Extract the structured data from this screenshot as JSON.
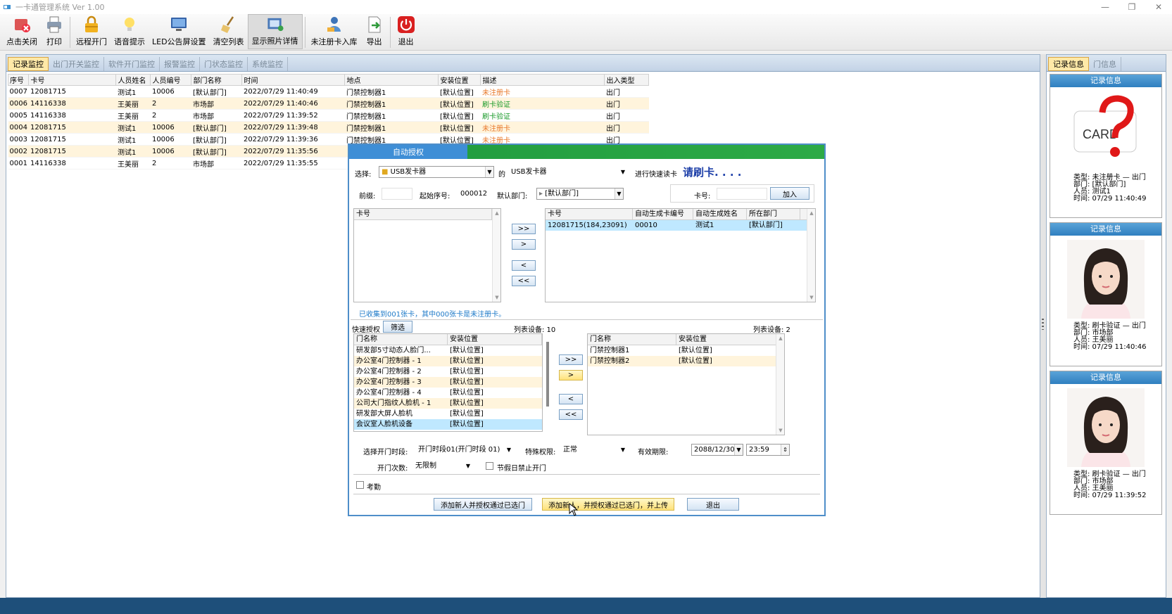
{
  "window": {
    "title": "一卡通管理系统  Ver 1.00"
  },
  "toolbar": {
    "buttons": [
      {
        "label": "点击关闭"
      },
      {
        "label": "打印"
      },
      {
        "label": "远程开门"
      },
      {
        "label": "语音提示"
      },
      {
        "label": "LED公告屏设置"
      },
      {
        "label": "清空列表"
      },
      {
        "label": "显示照片详情"
      },
      {
        "label": "未注册卡入库"
      },
      {
        "label": "导出"
      },
      {
        "label": "退出"
      }
    ]
  },
  "main": {
    "tabs": [
      "记录监控",
      "出门开关监控",
      "软件开门监控",
      "报警监控",
      "门状态监控",
      "系统监控"
    ],
    "table": {
      "headers": [
        "序号",
        "卡号",
        "人员姓名",
        "人员编号",
        "部门名称",
        "时间",
        "地点",
        "安装位置",
        "描述",
        "出入类型"
      ],
      "rows": [
        [
          "0007",
          "12081715",
          "测试1",
          "10006",
          "[默认部门]",
          "2022/07/29 11:40:49",
          "门禁控制器1",
          "[默认位置]",
          "未注册卡",
          "出门"
        ],
        [
          "0006",
          "14116338",
          "王美丽",
          "2",
          "市场部",
          "2022/07/29 11:40:46",
          "门禁控制器1",
          "[默认位置]",
          "刷卡验证",
          "出门"
        ],
        [
          "0005",
          "14116338",
          "王美丽",
          "2",
          "市场部",
          "2022/07/29 11:39:52",
          "门禁控制器1",
          "[默认位置]",
          "刷卡验证",
          "出门"
        ],
        [
          "0004",
          "12081715",
          "测试1",
          "10006",
          "[默认部门]",
          "2022/07/29 11:39:48",
          "门禁控制器1",
          "[默认位置]",
          "未注册卡",
          "出门"
        ],
        [
          "0003",
          "12081715",
          "测试1",
          "10006",
          "[默认部门]",
          "2022/07/29 11:39:36",
          "门禁控制器1",
          "[默认位置]",
          "未注册卡",
          "出门"
        ],
        [
          "0002",
          "12081715",
          "测试1",
          "10006",
          "[默认部门]",
          "2022/07/29 11:35:56",
          "",
          "",
          "",
          ""
        ],
        [
          "0001",
          "14116338",
          "王美丽",
          "2",
          "市场部",
          "2022/07/29 11:35:55",
          "",
          "",
          "",
          ""
        ]
      ]
    }
  },
  "right": {
    "tabs": [
      "记录信息",
      "门信息"
    ],
    "cards": [
      {
        "head": "记录信息",
        "line1": "类型: 未注册卡 — 出门",
        "line2": "部门: [默认部门]",
        "line3": "人员: 测试1",
        "line4": "时间: 07/29 11:40:49",
        "pic": "card-question"
      },
      {
        "head": "记录信息",
        "line1": "类型: 刷卡验证 — 出门",
        "line2": "部门: 市场部",
        "line3": "人员: 王美丽",
        "line4": "时间: 07/29 11:40:46",
        "pic": "person-photo"
      },
      {
        "head": "记录信息",
        "line1": "类型: 刷卡验证 — 出门",
        "line2": "部门: 市场部",
        "line3": "人员: 王美丽",
        "line4": "时间: 07/29 11:39:52",
        "pic": "person-photo"
      }
    ],
    "card_text": "CARD"
  },
  "dialog": {
    "title": "自动授权",
    "select_label": "选择:",
    "reader_combo": "USB发卡器",
    "of_label": "的",
    "reader_combo2": "USB发卡器",
    "quick_read_label": "进行快速读卡",
    "swipe_prompt": "请刷卡. . . .",
    "prefix_label": "前缀:",
    "prefix_value": "",
    "start_label": "起始序号:",
    "start_value": "000012",
    "dept_label": "默认部门:",
    "dept_value": "[默认部门]",
    "cardno_label": "卡号:",
    "cardno_value": "",
    "add_button": "加入",
    "left_list_header": "卡号",
    "right_list": {
      "headers": [
        "卡号",
        "自动生成卡编号",
        "自动生成姓名",
        "所在部门"
      ],
      "rows": [
        [
          "12081715(184,23091)",
          "00010",
          "测试1",
          "[默认部门]"
        ]
      ]
    },
    "move_buttons": [
      ">>",
      ">",
      "<",
      "<<"
    ],
    "collected_msg": "已收集到001张卡，其中000张卡是未注册卡。",
    "quick_auth_label": "快速授权",
    "filter_button": "筛选",
    "left_count": "列表设备: 10",
    "right_count": "列表设备: 2",
    "door_headers": [
      "门名称",
      "安装位置"
    ],
    "doors_left": [
      [
        "研发部5寸动态人脸门...",
        "[默认位置]"
      ],
      [
        "办公室4门控制器 - 1",
        "[默认位置]"
      ],
      [
        "办公室4门控制器 - 2",
        "[默认位置]"
      ],
      [
        "办公室4门控制器 - 3",
        "[默认位置]"
      ],
      [
        "办公室4门控制器 - 4",
        "[默认位置]"
      ],
      [
        "公司大门指纹人脸机 - 1",
        "[默认位置]"
      ],
      [
        "研发部大屏人脸机",
        "[默认位置]"
      ],
      [
        "会议室人脸机设备",
        "[默认位置]"
      ]
    ],
    "doors_right": [
      [
        "门禁控制器1",
        "[默认位置]"
      ],
      [
        "门禁控制器2",
        "[默认位置]"
      ]
    ],
    "period_label": "选择开门时段:",
    "period_value": "开门时段01(开门时段 01)",
    "special_label": "特殊权限:",
    "special_value": "正常",
    "valid_label": "有效期限:",
    "valid_date": "2088/12/30",
    "valid_time": "23:59",
    "count_label": "开门次数:",
    "count_value": "无限制",
    "holiday_label": "节假日禁止开门",
    "attendance_label": "考勤",
    "btn_add_auth": "添加新人并授权通过已选门",
    "btn_add_auth_upload": "添加新人，并授权通过已选门，并上传",
    "btn_exit": "退出"
  }
}
